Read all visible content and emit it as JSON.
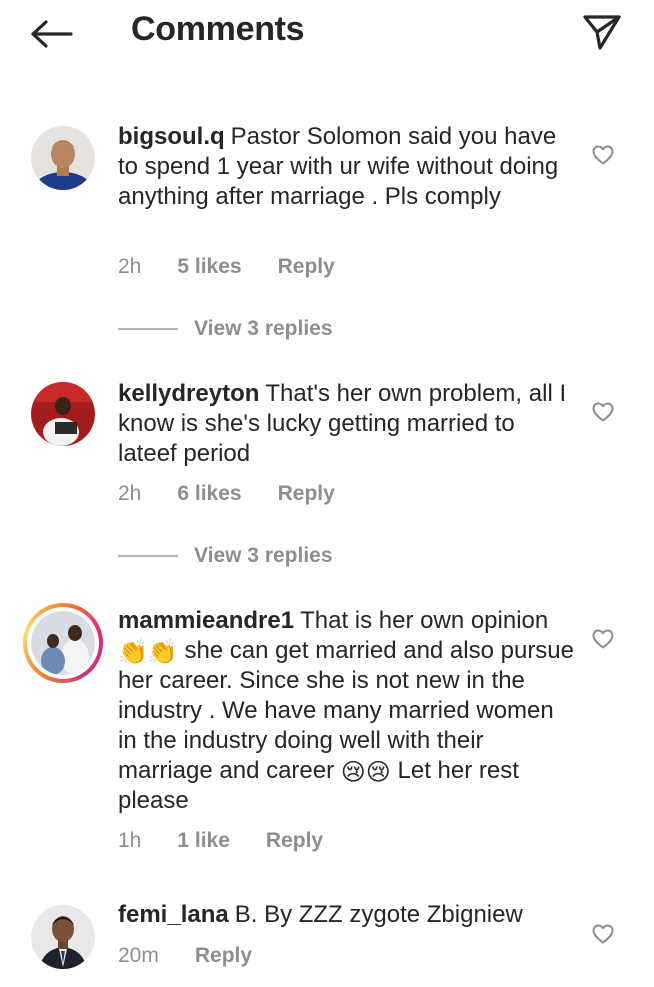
{
  "header": {
    "title": "Comments",
    "back_icon": "arrow-left-icon",
    "share_icon": "send-icon"
  },
  "comments": [
    {
      "username": "bigsoul.q",
      "text": "Pastor Solomon said you have to spend 1 year with ur wife without doing anything after marriage . Pls comply",
      "time": "2h",
      "likes": "5 likes",
      "reply": "Reply",
      "view_replies": "View 3 replies"
    },
    {
      "username": "kellydreyton",
      "text": "That's her own problem, all I know is she's lucky getting married to lateef period",
      "time": "2h",
      "likes": "6 likes",
      "reply": "Reply",
      "view_replies": "View 3 replies"
    },
    {
      "username": "mammieandre1",
      "text_part1": "That is her own opinion",
      "emoji1": "👏👏",
      "text_part2": "she can get married and also pursue her career. Since she is not new in the industry . We have many married women in the industry doing well with their marriage and career",
      "emoji2": "😢😢",
      "text_part3": "Let her rest please",
      "time": "1h",
      "likes": "1 like",
      "reply": "Reply"
    },
    {
      "username": "femi_lana",
      "text": "B. By ZZZ zygote Zbigniew",
      "time": "20m",
      "reply": "Reply"
    }
  ],
  "colors": {
    "text": "#262626",
    "muted": "#8e8e8e",
    "background": "#ffffff"
  }
}
